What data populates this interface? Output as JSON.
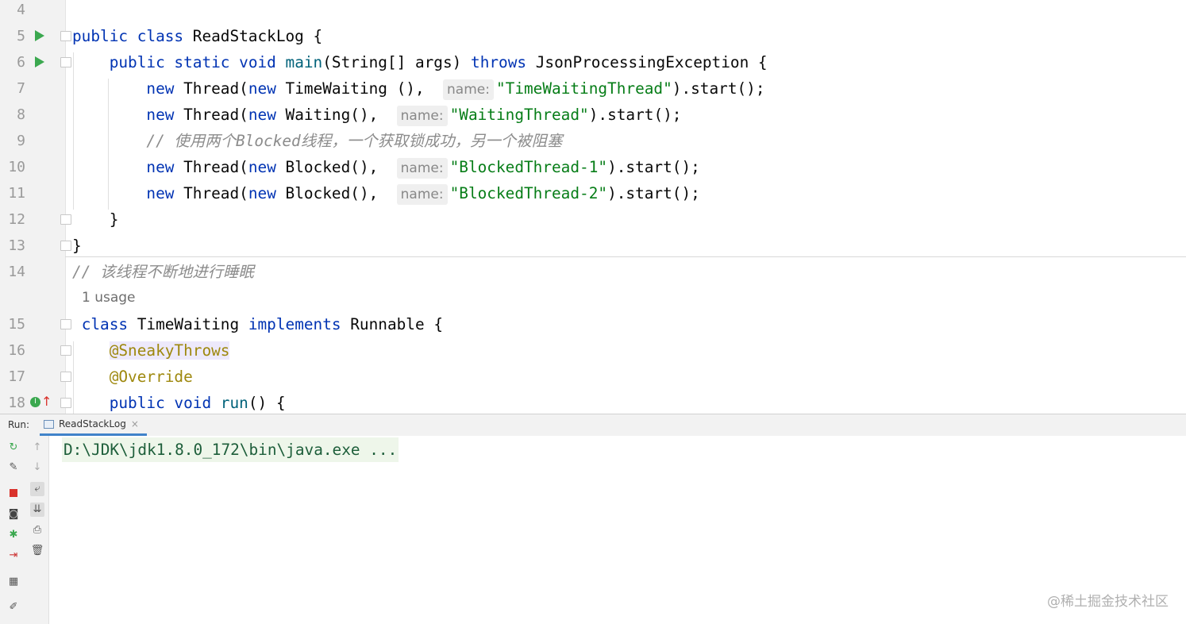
{
  "editor": {
    "lines": [
      {
        "n": "4",
        "html": ""
      },
      {
        "n": "5",
        "html": "<span class='kw'>public class </span>ReadStackLog {"
      },
      {
        "n": "6",
        "html": "    <span class='kw'>public static void </span><span class='fn'>main</span>(String[] args) <span class='kw'>throws </span>JsonProcessingException {"
      },
      {
        "n": "7",
        "html": "        <span class='kw'>new </span>Thread(<span class='kw'>new </span>TimeWaiting (),  <span class='hint'>name:</span><span class='str'>\"TimeWaitingThread\"</span>).start();"
      },
      {
        "n": "8",
        "html": "        <span class='kw'>new </span>Thread(<span class='kw'>new </span>Waiting(),  <span class='hint'>name:</span><span class='str'>\"WaitingThread\"</span>).start();"
      },
      {
        "n": "9",
        "html": "        <span class='cm'>// 使用两个Blocked线程，一个获取锁成功，另一个被阻塞</span>"
      },
      {
        "n": "10",
        "html": "        <span class='kw'>new </span>Thread(<span class='kw'>new </span>Blocked(),  <span class='hint'>name:</span><span class='str'>\"BlockedThread-1\"</span>).start();"
      },
      {
        "n": "11",
        "html": "        <span class='kw'>new </span>Thread(<span class='kw'>new </span>Blocked(),  <span class='hint'>name:</span><span class='str'>\"BlockedThread-2\"</span>).start();"
      },
      {
        "n": "12",
        "html": "    }"
      },
      {
        "n": "13",
        "html": "}"
      },
      {
        "n": "14",
        "html": "<span class='cm'>// 该线程不断地进行睡眠</span>"
      },
      {
        "n": "",
        "html": ""
      },
      {
        "n": "15",
        "html": " <span class='kw'>class </span>TimeWaiting <span class='kw'>implements </span>Runnable {"
      },
      {
        "n": "16",
        "html": "    <span class='ann annhl'>@SneakyThrows</span>"
      },
      {
        "n": "17",
        "html": "    <span class='ann'>@Override</span>"
      },
      {
        "n": "18",
        "html": "    <span class='kw'>public void </span><span class='fn'>run</span>() {"
      }
    ],
    "usage_label": "1 usage"
  },
  "run_panel": {
    "label": "Run:",
    "tab_label": "ReadStackLog",
    "tab_close": "×",
    "output_line": "D:\\JDK\\jdk1.8.0_172\\bin\\java.exe ..."
  },
  "watermark": "@稀土掘金技术社区"
}
